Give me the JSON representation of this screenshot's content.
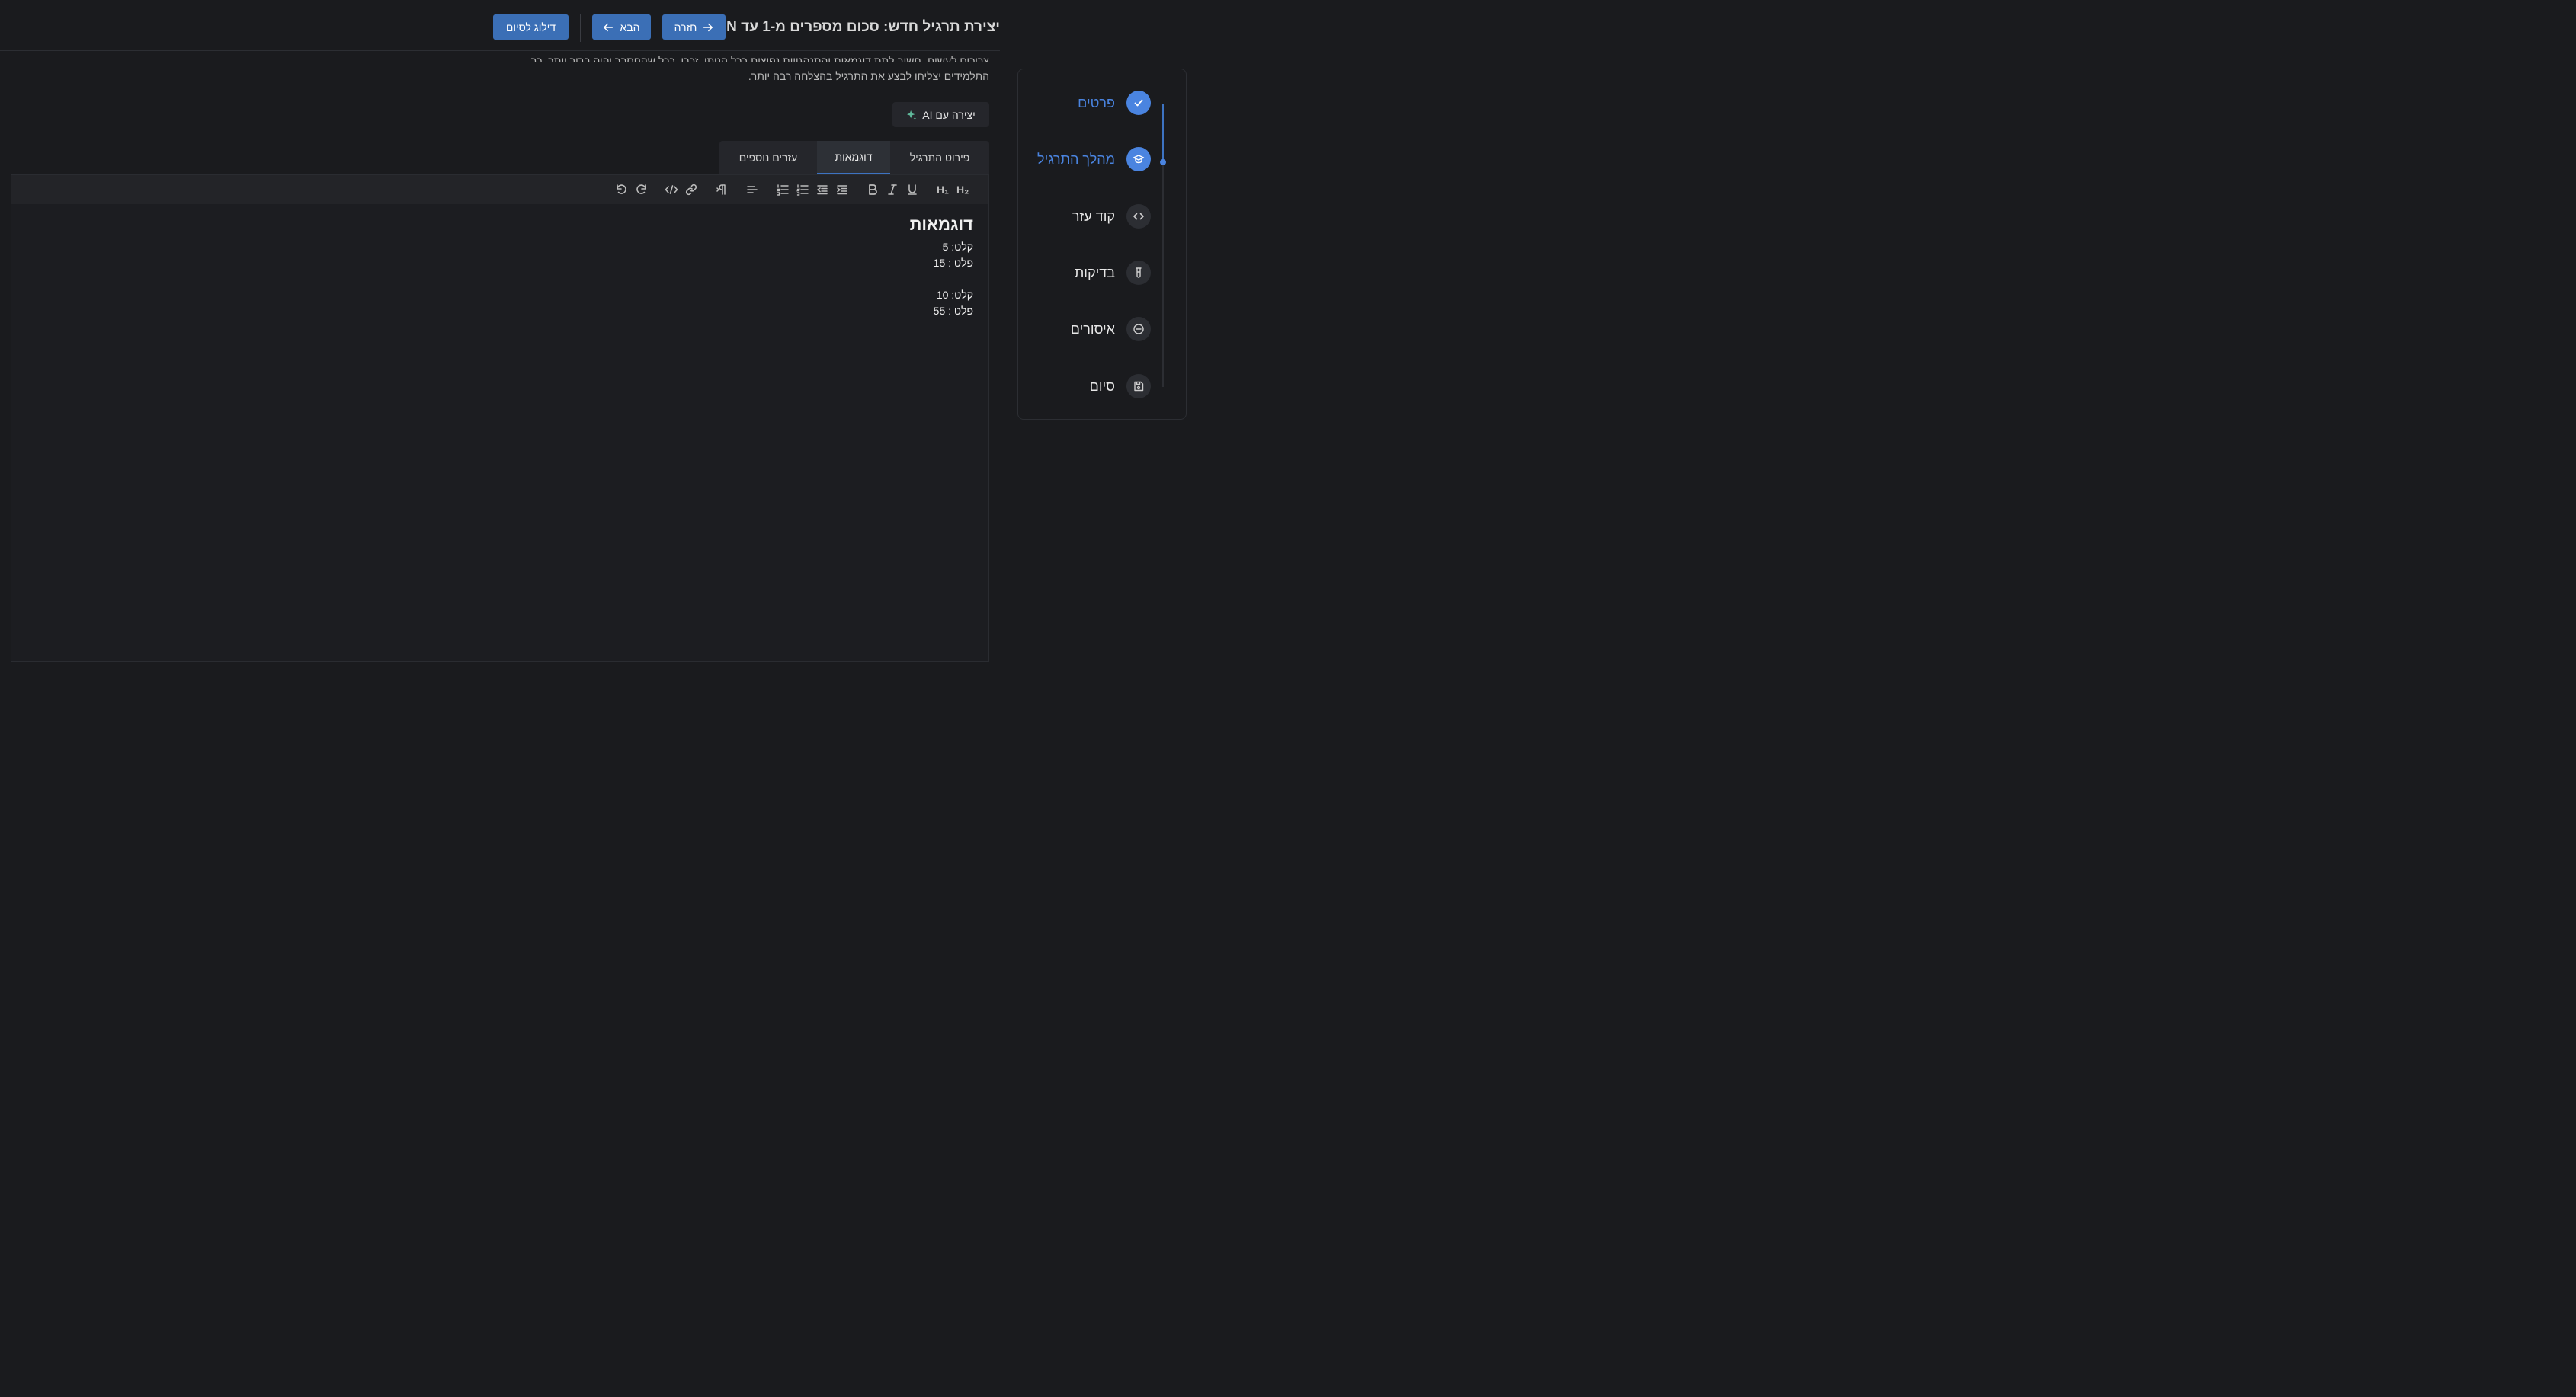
{
  "header": {
    "title": "יצירת תרגיל חדש: סכום מספרים מ-1 עד N",
    "back_label": "חזרה",
    "next_label": "הבא",
    "skip_label": "דילוג לסיום"
  },
  "description": {
    "line1": "צריכים לעשות. חשוב לתת דוגמאות והתנהגויות נפוצות ככל הניתן. זכרו, ככל שהחסבר יהיה ברור יותר, כך",
    "line2": "התלמידים יצליחו לבצע את התרגיל בהצלחה רבה יותר."
  },
  "ai_button": {
    "label": "יצירה עם AI",
    "icon": "sparkle-icon"
  },
  "tabs": [
    {
      "label": "פירוט התרגיל",
      "active": false
    },
    {
      "label": "דוגמאות",
      "active": true
    },
    {
      "label": "עזרים נוספים",
      "active": false
    }
  ],
  "toolbar": {
    "h2": "H₂",
    "h1": "H₁"
  },
  "editor": {
    "heading": "דוגמאות",
    "lines": [
      "קלט: 5",
      "פלט : 15",
      "",
      "קלט: 10",
      "פלט : 55"
    ]
  },
  "steps": [
    {
      "label": "פרטים",
      "icon": "check-icon",
      "state": "completed"
    },
    {
      "label": "מהלך התרגיל",
      "icon": "graduation-cap-icon",
      "state": "active"
    },
    {
      "label": "קוד עזר",
      "icon": "code-icon",
      "state": "pending"
    },
    {
      "label": "בדיקות",
      "icon": "test-tube-icon",
      "state": "pending"
    },
    {
      "label": "איסורים",
      "icon": "minus-circle-icon",
      "state": "pending"
    },
    {
      "label": "סיום",
      "icon": "save-icon",
      "state": "pending"
    }
  ],
  "colors": {
    "accent": "#3b6fb6",
    "active": "#4a84e0",
    "background": "#1a1b1e"
  }
}
